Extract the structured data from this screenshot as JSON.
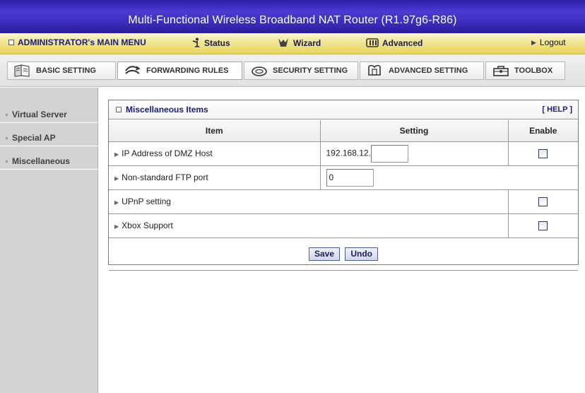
{
  "window": {
    "title": "Multi-Functional Wireless Broadband NAT Router (R1.97g6-R86)"
  },
  "main_menu": {
    "admin_label": "ADMINISTRATOR's MAIN MENU",
    "status_label": "Status",
    "wizard_label": "Wizard",
    "advanced_label": "Advanced",
    "logout_label": "Logout"
  },
  "tabs": [
    {
      "label": "BASIC SETTING",
      "icon": "basic-setting-icon",
      "active": false
    },
    {
      "label": "FORWARDING RULES",
      "icon": "forwarding-rules-icon",
      "active": true
    },
    {
      "label": "SECURITY SETTING",
      "icon": "security-setting-icon",
      "active": false
    },
    {
      "label": "ADVANCED SETTING",
      "icon": "advanced-setting-icon",
      "active": false
    },
    {
      "label": "TOOLBOX",
      "icon": "toolbox-icon",
      "active": false
    }
  ],
  "sidebar": {
    "items": [
      {
        "label": "Virtual Server"
      },
      {
        "label": "Special AP"
      },
      {
        "label": "Miscellaneous"
      }
    ]
  },
  "panel": {
    "title": "Miscellaneous Items",
    "help_label": "[ HELP ]",
    "columns": [
      "Item",
      "Setting",
      "Enable"
    ],
    "rows": [
      {
        "label": "IP Address of DMZ Host",
        "setting_prefix": "192.168.12.",
        "setting_value": "",
        "enable": false
      },
      {
        "label": "Non-standard FTP port",
        "setting_value": "0"
      },
      {
        "label": "UPnP setting",
        "enable": false
      },
      {
        "label": "Xbox Support",
        "enable": false
      }
    ],
    "save_label": "Save",
    "undo_label": "Undo"
  },
  "colors": {
    "title_bar": "#3a2ec0",
    "menu_bar": "#f1e79a",
    "sidebar": "#d3d3d3",
    "accent_text": "#1d1b7a"
  }
}
